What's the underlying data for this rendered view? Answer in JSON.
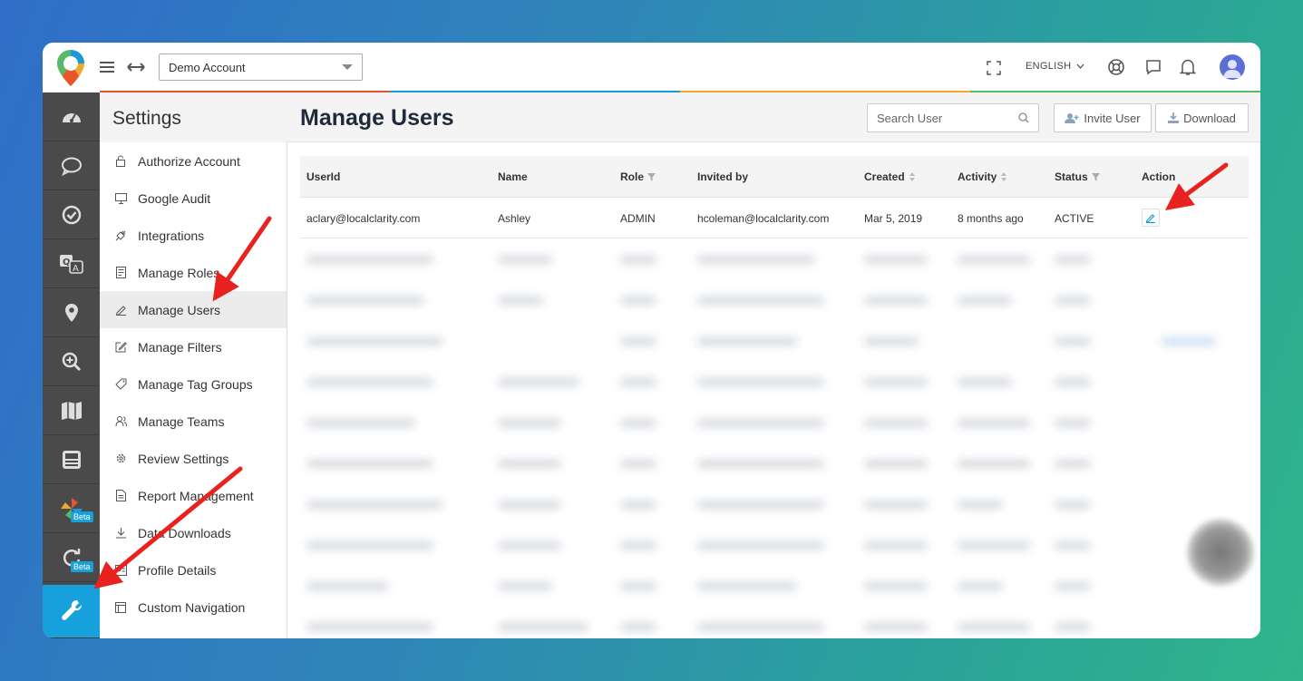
{
  "topbar": {
    "account": "Demo Account",
    "language": "ENGLISH"
  },
  "colors": {
    "accent": "#16a1dc",
    "rail_bg": "#4a4a4a",
    "line": [
      "#e8542c",
      "#1a9ad6",
      "#f0a830",
      "#59b96b"
    ],
    "arrow": "#e8231f"
  },
  "rail": {
    "items": [
      {
        "icon": "dashboard-gauge-icon"
      },
      {
        "icon": "chat-bubble-icon"
      },
      {
        "icon": "check-circle-icon"
      },
      {
        "icon": "translate-icon"
      },
      {
        "icon": "location-pin-icon"
      },
      {
        "icon": "zoom-in-icon"
      },
      {
        "icon": "map-icon"
      },
      {
        "icon": "panels-icon"
      },
      {
        "icon": "pinwheel-icon",
        "badge": "Beta"
      },
      {
        "icon": "refresh-icon",
        "badge": "Beta"
      },
      {
        "icon": "wrench-icon"
      }
    ]
  },
  "settings": {
    "title": "Settings",
    "items": [
      {
        "label": "Authorize Account",
        "icon": "lock-icon"
      },
      {
        "label": "Google Audit",
        "icon": "monitor-icon"
      },
      {
        "label": "Integrations",
        "icon": "plug-icon"
      },
      {
        "label": "Manage Roles",
        "icon": "document-list-icon"
      },
      {
        "label": "Manage Users",
        "icon": "pencil-icon"
      },
      {
        "label": "Manage Filters",
        "icon": "edit-box-icon"
      },
      {
        "label": "Manage Tag Groups",
        "icon": "tag-icon"
      },
      {
        "label": "Manage Teams",
        "icon": "team-icon"
      },
      {
        "label": "Review Settings",
        "icon": "gear-icon"
      },
      {
        "label": "Report Management",
        "icon": "file-icon"
      },
      {
        "label": "Data Downloads",
        "icon": "download-icon"
      },
      {
        "label": "Profile Details",
        "icon": "profile-icon"
      },
      {
        "label": "Custom Navigation",
        "icon": "window-icon"
      }
    ]
  },
  "main": {
    "title": "Manage Users",
    "search_placeholder": "Search User",
    "invite_label": "Invite User",
    "download_label": "Download",
    "columns": [
      "UserId",
      "Name",
      "Role",
      "Invited by",
      "Created",
      "Activity",
      "Status",
      "Action"
    ],
    "rows": [
      {
        "userid": "aclary@localclarity.com",
        "name": "Ashley",
        "role": "ADMIN",
        "invited_by": "hcoleman@localclarity.com",
        "created": "Mar 5, 2019",
        "activity": "8 months ago",
        "status": "ACTIVE"
      }
    ]
  }
}
